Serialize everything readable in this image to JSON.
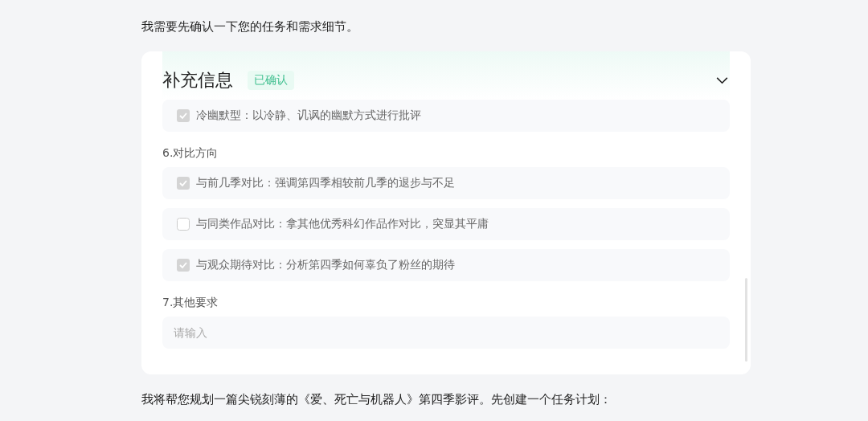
{
  "intro": "我需要先确认一下您的任务和需求细节。",
  "card": {
    "title": "补充信息",
    "badge": "已确认",
    "expanded": true,
    "sections": [
      {
        "options": [
          {
            "label": "冷幽默型：以冷静、讥讽的幽默方式进行批评",
            "checked": true
          }
        ]
      },
      {
        "label": "6.对比方向",
        "options": [
          {
            "label": "与前几季对比：强调第四季相较前几季的退步与不足",
            "checked": true
          },
          {
            "label": "与同类作品对比：拿其他优秀科幻作品作对比，突显其平庸",
            "checked": false
          },
          {
            "label": "与观众期待对比：分析第四季如何辜负了粉丝的期待",
            "checked": true
          }
        ]
      },
      {
        "label": "7.其他要求",
        "input": {
          "placeholder": "请输入"
        }
      }
    ]
  },
  "outro": "我将帮您规划一篇尖锐刻薄的《爱、死亡与机器人》第四季影评。先创建一个任务计划："
}
